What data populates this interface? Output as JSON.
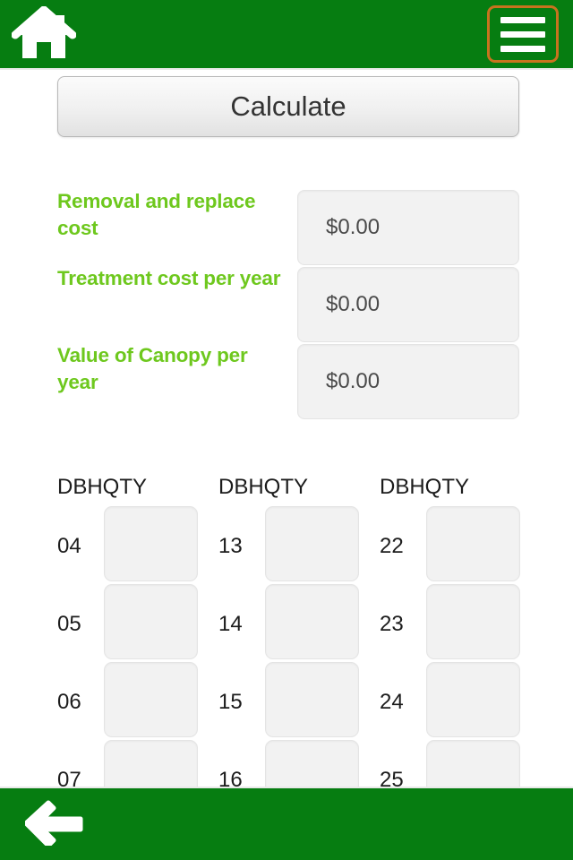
{
  "theme": {
    "header_green": "#067d11",
    "label_green": "#6ec81e",
    "menu_border_orange": "#c8731e",
    "field_bg": "#f2f2f2"
  },
  "header": {
    "home_icon": "home-icon",
    "menu_icon": "hamburger-menu-icon"
  },
  "toolbar": {
    "calculate_label": "Calculate"
  },
  "results": [
    {
      "label": "Removal and replace cost",
      "value": "$0.00"
    },
    {
      "label": "Treatment cost per year",
      "value": "$0.00"
    },
    {
      "label": "Value of Canopy per year",
      "value": "$0.00"
    }
  ],
  "table": {
    "header_dbh": "DBH",
    "header_qty": "QTY",
    "columns": [
      {
        "rows": [
          {
            "dbh": "04",
            "qty": ""
          },
          {
            "dbh": "05",
            "qty": ""
          },
          {
            "dbh": "06",
            "qty": ""
          },
          {
            "dbh": "07",
            "qty": ""
          }
        ]
      },
      {
        "rows": [
          {
            "dbh": "13",
            "qty": ""
          },
          {
            "dbh": "14",
            "qty": ""
          },
          {
            "dbh": "15",
            "qty": ""
          },
          {
            "dbh": "16",
            "qty": ""
          }
        ]
      },
      {
        "rows": [
          {
            "dbh": "22",
            "qty": ""
          },
          {
            "dbh": "23",
            "qty": ""
          },
          {
            "dbh": "24",
            "qty": ""
          },
          {
            "dbh": "25",
            "qty": ""
          }
        ]
      }
    ]
  },
  "footer": {
    "back_icon": "back-arrow-icon"
  }
}
